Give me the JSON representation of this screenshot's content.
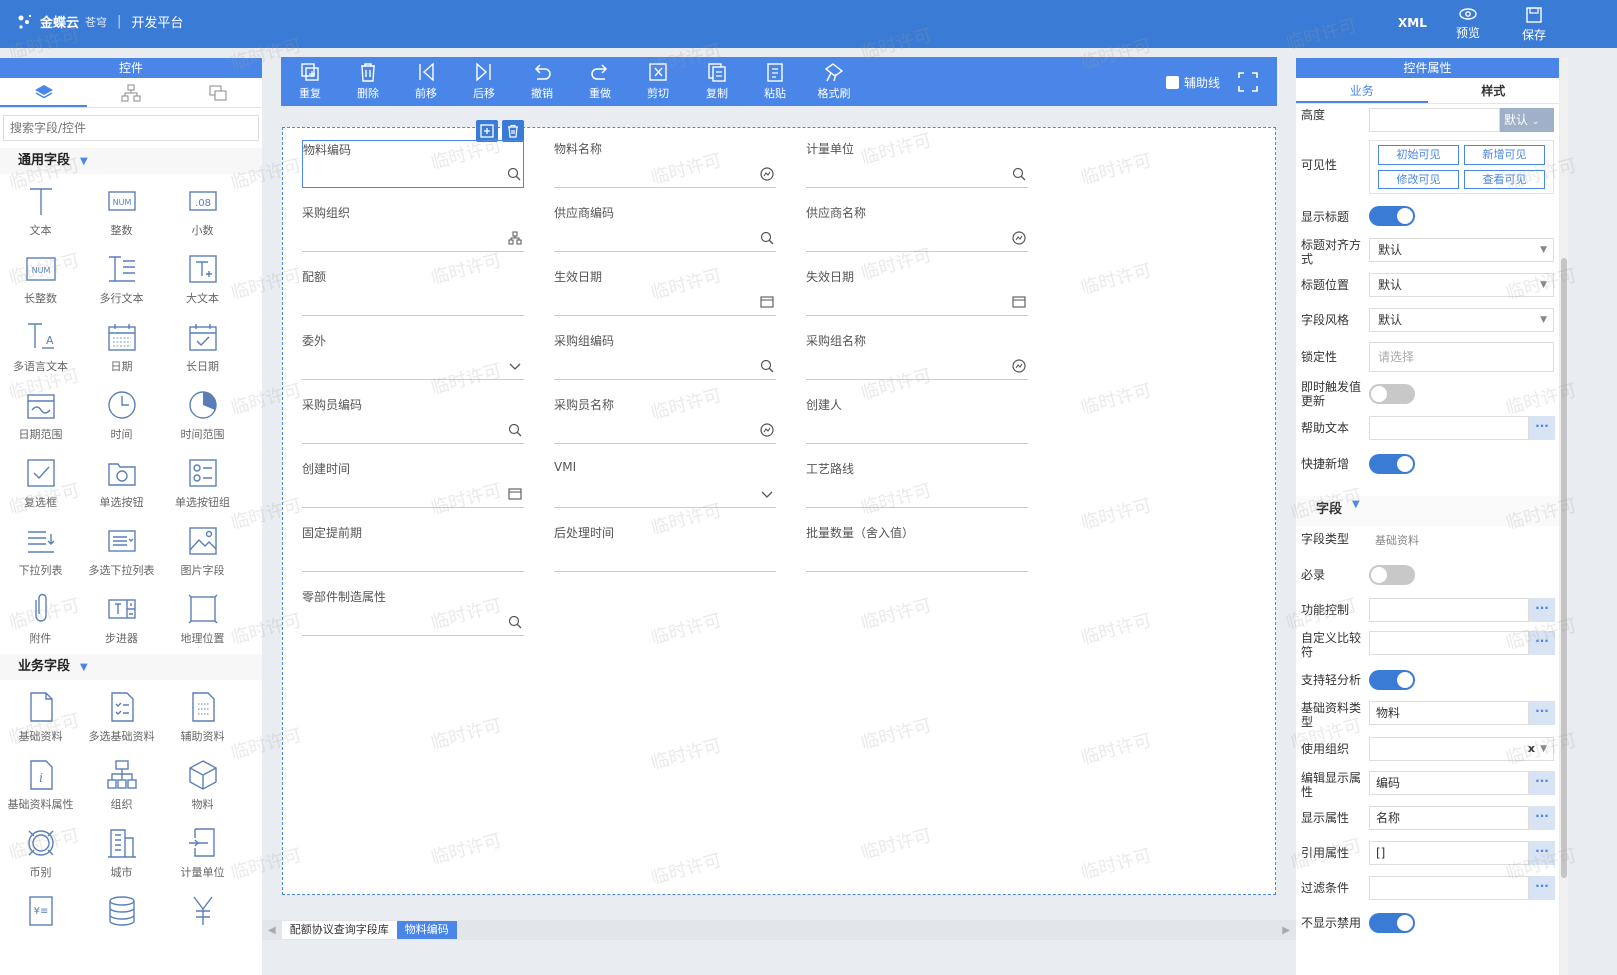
{
  "header": {
    "brand": "金蝶云",
    "brand_sub": "苍穹",
    "platform": "开发平台",
    "xml": "XML",
    "preview": "预览",
    "save": "保存"
  },
  "left": {
    "title": "控件",
    "search_placeholder": "搜索字段/控件",
    "common_title": "通用字段",
    "common": [
      {
        "label": "文本",
        "icon": "text-icon"
      },
      {
        "label": "整数",
        "icon": "integer-icon"
      },
      {
        "label": "小数",
        "icon": "decimal-icon"
      },
      {
        "label": "长整数",
        "icon": "long-integer-icon"
      },
      {
        "label": "多行文本",
        "icon": "multiline-text-icon"
      },
      {
        "label": "大文本",
        "icon": "large-text-icon"
      },
      {
        "label": "多语言文本",
        "icon": "multilang-text-icon"
      },
      {
        "label": "日期",
        "icon": "date-icon"
      },
      {
        "label": "长日期",
        "icon": "long-date-icon"
      },
      {
        "label": "日期范围",
        "icon": "date-range-icon"
      },
      {
        "label": "时间",
        "icon": "time-icon"
      },
      {
        "label": "时间范围",
        "icon": "time-range-icon"
      },
      {
        "label": "复选框",
        "icon": "checkbox-icon"
      },
      {
        "label": "单选按钮",
        "icon": "radio-icon"
      },
      {
        "label": "单选按钮组",
        "icon": "radio-group-icon"
      },
      {
        "label": "下拉列表",
        "icon": "dropdown-icon"
      },
      {
        "label": "多选下拉列表",
        "icon": "multi-dropdown-icon"
      },
      {
        "label": "图片字段",
        "icon": "image-icon"
      },
      {
        "label": "附件",
        "icon": "attachment-icon"
      },
      {
        "label": "步进器",
        "icon": "stepper-icon"
      },
      {
        "label": "地理位置",
        "icon": "location-icon"
      }
    ],
    "biz_title": "业务字段",
    "biz": [
      {
        "label": "基础资料",
        "icon": "basedata-icon"
      },
      {
        "label": "多选基础资料",
        "icon": "multi-basedata-icon"
      },
      {
        "label": "辅助资料",
        "icon": "assist-data-icon"
      },
      {
        "label": "基础资料属性",
        "icon": "basedata-prop-icon"
      },
      {
        "label": "组织",
        "icon": "org-icon"
      },
      {
        "label": "物料",
        "icon": "material-icon"
      },
      {
        "label": "币别",
        "icon": "currency-icon"
      },
      {
        "label": "城市",
        "icon": "city-icon"
      },
      {
        "label": "计量单位",
        "icon": "unit-icon"
      },
      {
        "label": "",
        "icon": "doc-icon"
      },
      {
        "label": "",
        "icon": "database-icon"
      },
      {
        "label": "",
        "icon": "yuan-icon"
      }
    ]
  },
  "toolbar": {
    "items": [
      "重复",
      "删除",
      "前移",
      "后移",
      "撤销",
      "重做",
      "剪切",
      "复制",
      "粘贴",
      "格式刷"
    ],
    "guide": "辅助线"
  },
  "fields": [
    {
      "label": "物料编码",
      "icon": "search"
    },
    {
      "label": "物料名称",
      "icon": "lookup"
    },
    {
      "label": "计量单位",
      "icon": "search"
    },
    {
      "label": "采购组织",
      "icon": "org"
    },
    {
      "label": "供应商编码",
      "icon": "search"
    },
    {
      "label": "供应商名称",
      "icon": "lookup"
    },
    {
      "label": "配额",
      "icon": ""
    },
    {
      "label": "生效日期",
      "icon": "date"
    },
    {
      "label": "失效日期",
      "icon": "date"
    },
    {
      "label": "委外",
      "icon": "chevron"
    },
    {
      "label": "采购组编码",
      "icon": "search"
    },
    {
      "label": "采购组名称",
      "icon": "lookup"
    },
    {
      "label": "采购员编码",
      "icon": "search"
    },
    {
      "label": "采购员名称",
      "icon": "lookup"
    },
    {
      "label": "创建人",
      "icon": ""
    },
    {
      "label": "创建时间",
      "icon": "date"
    },
    {
      "label": "VMI",
      "icon": "chevron"
    },
    {
      "label": "工艺路线",
      "icon": ""
    },
    {
      "label": "固定提前期",
      "icon": ""
    },
    {
      "label": "后处理时间",
      "icon": ""
    },
    {
      "label": "批量数量（舍入值）",
      "icon": ""
    },
    {
      "label": "零部件制造属性",
      "icon": "search"
    }
  ],
  "breadcrumb": [
    "配额协议查询字段库",
    "物料编码"
  ],
  "right": {
    "title": "控件属性",
    "tab_biz": "业务",
    "tab_style": "样式",
    "height_label": "高度",
    "height_default": "默认",
    "visible_label": "可见性",
    "visible_btns": [
      "初始可见",
      "新增可见",
      "修改可见",
      "查看可见"
    ],
    "show_title": "显示标题",
    "title_align": "标题对齐方式",
    "title_align_val": "默认",
    "title_pos": "标题位置",
    "title_pos_val": "默认",
    "field_style": "字段风格",
    "field_style_val": "默认",
    "lock": "锁定性",
    "lock_ph": "请选择",
    "instant": "即时触发值更新",
    "help": "帮助文本",
    "quick_add": "快捷新增",
    "field_section": "字段",
    "field_type": "字段类型",
    "field_type_val": "基础资料",
    "required": "必录",
    "func_ctrl": "功能控制",
    "custom_cmp": "自定义比较符",
    "light_analysis": "支持轻分析",
    "basedata_type": "基础资料类型",
    "basedata_type_val": "物料",
    "use_org": "使用组织",
    "use_org_clear": "x",
    "edit_display": "编辑显示属性",
    "edit_display_val": "编码",
    "display_prop": "显示属性",
    "display_prop_val": "名称",
    "ref_prop": "引用属性",
    "ref_prop_val": "[]",
    "filter": "过滤条件",
    "hide_disabled": "不显示禁用"
  },
  "watermark": "临时许可"
}
